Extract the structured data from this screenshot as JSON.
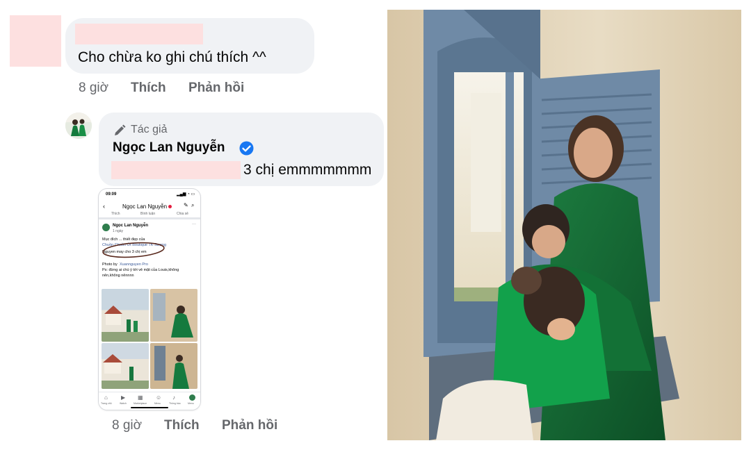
{
  "comment1": {
    "text": "Cho chừa ko ghi chú thích ^^",
    "time": "8 giờ",
    "like": "Thích",
    "reply": "Phản hồi"
  },
  "reply": {
    "author_tag": "Tác giả",
    "author_name": "Ngọc Lan Nguyễn",
    "text_suffix": "3 chị emmmmmmm",
    "time": "8 giờ",
    "like": "Thích",
    "reply": "Phản hồi",
    "attachment": {
      "status_time": "09:09",
      "header_name": "Ngọc Lan Nguyễn",
      "tabs": [
        "Thích",
        "Bình luận",
        "Chia sẻ"
      ],
      "post_author": "Ngọc Lan Nguyễn",
      "post_time": "1 ngày",
      "caption_line1": "Mục đích ... thiết đẹp của",
      "caption_line2": "Chuồn Chuồn Ớt Boutique TK Sương",
      "caption_line3": "Nguyen may cho 3 chị em",
      "photo_by_label": "Photo by",
      "photo_by": "Xuannguyen Pro",
      "ps_line1": "Ps: đừng ai chú ý tới vẻ mặt của Louis,không",
      "ps_line2": "nên,không nênnnn",
      "bottom_nav": [
        "Trang chủ",
        "Watch",
        "Marketplace",
        "Menu",
        "Thông báo",
        "Menu"
      ]
    }
  },
  "colors": {
    "bubble": "#f0f2f5",
    "meta": "#65676b",
    "verified": "#1877f2",
    "redaction": "#fde0e0"
  }
}
